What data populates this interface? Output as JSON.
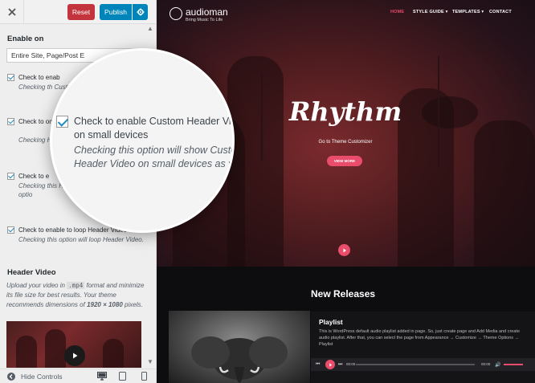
{
  "customizer": {
    "topbar": {
      "reset_label": "Reset",
      "publish_label": "Publish"
    },
    "enable_on": {
      "label": "Enable on",
      "select_value": "Entire Site, Page/Post E"
    },
    "options": [
      {
        "title": "Check to enab",
        "desc": "Checking th Custom H",
        "checked": true
      },
      {
        "title": "Check to on small",
        "desc": "Checking Header",
        "checked": true
      },
      {
        "title": "Check to e",
        "desc": "Checking this Header Video. A enable sound optio",
        "checked": true
      },
      {
        "title": "Check to enable to loop Header Video",
        "desc": "Checking this option will loop Header Video.",
        "checked": true
      }
    ],
    "header_video": {
      "label": "Header Video",
      "desc_pre": "Upload your video in",
      "desc_code": ".mp4",
      "desc_mid": "format and minimize its file size for best results. Your theme recommends dimensions of",
      "desc_dims": "1920 × 1080",
      "desc_post": "pixels."
    },
    "footer": {
      "hide_controls_label": "Hide Controls"
    }
  },
  "magnifier": {
    "title": "Check to enable Custom Header Video on small devices",
    "desc": "Checking this option will show Custom Header Video on small devices as well.",
    "checked": true
  },
  "site": {
    "name": "audioman",
    "tagline": "Bring Music To Life",
    "nav": [
      {
        "label": "HOME",
        "active": true
      },
      {
        "label": "STYLE GUIDE ▾",
        "active": false
      },
      {
        "label": "TEMPLATES ▾",
        "active": false
      },
      {
        "label": "CONTACT",
        "active": false
      }
    ],
    "hero": {
      "title": "Rhythm",
      "subtitle": "Go to Theme Customizer",
      "button": "VIEW MORE"
    },
    "releases_title": "New Releases",
    "playlist": {
      "title": "Playlist",
      "desc": "This is WordPress default audio playlist added in page. So, just create page and Add Media and create audio playlist. After that, you can select the page from Appearance → Customize → Theme Options → Playlist",
      "time_start": "00:00",
      "time_end": "00:00"
    }
  },
  "colors": {
    "reset": "#c3343c",
    "publish": "#0085ba",
    "accent_pink": "#ea4c6b",
    "checkbox_check": "#1e8cbe"
  }
}
